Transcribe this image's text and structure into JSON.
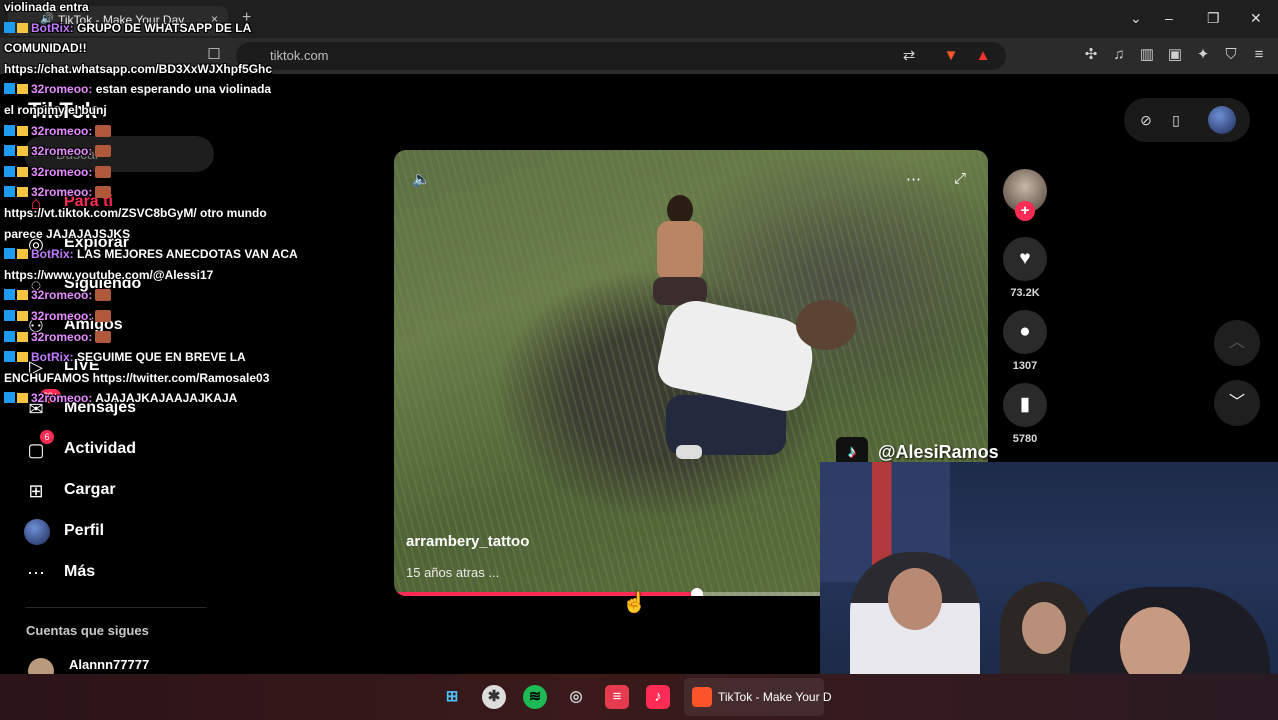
{
  "browser": {
    "tab_title": "TikTok - Make Your Day",
    "tab_close": "×",
    "new_tab": "+",
    "url": "tiktok.com"
  },
  "sidebar": {
    "logo": "TikTok",
    "search_placeholder": "Buscar",
    "items": [
      {
        "label": "Para ti",
        "icon": "home-icon"
      },
      {
        "label": "Explorar",
        "icon": "compass-icon"
      },
      {
        "label": "Siguiendo",
        "icon": "following-icon"
      },
      {
        "label": "Amigos",
        "icon": "friends-icon"
      },
      {
        "label": "LIVE",
        "icon": "live-icon"
      },
      {
        "label": "Mensajes",
        "icon": "messages-icon",
        "badge": "99+"
      },
      {
        "label": "Actividad",
        "icon": "activity-icon",
        "badge": "6"
      },
      {
        "label": "Cargar",
        "icon": "upload-icon"
      },
      {
        "label": "Perfil",
        "icon": "profile-avatar"
      },
      {
        "label": "Más",
        "icon": "more-icon"
      }
    ],
    "following_title": "Cuentas que sigues",
    "following_users": [
      "Alannn77777"
    ]
  },
  "video": {
    "author": "arrambery_tattoo",
    "posted": "15 años atras ...",
    "progress": 0.51
  },
  "actions": {
    "likes": "73.2K",
    "comments": "1307",
    "saves": "5780"
  },
  "stream": {
    "handle": "@AlesiRamos"
  },
  "chat": [
    {
      "user": "",
      "text": "violinada entra"
    },
    {
      "user": "BotRix:",
      "text": " GRUPO DE WHATSAPP DE LA"
    },
    {
      "user": "",
      "text": "COMUNIDAD!!"
    },
    {
      "user": "",
      "text": "https://chat.whatsapp.com/BD3XxWJXhpf5Ghc"
    },
    {
      "user": "32romeoo:",
      "text": " estan esperando una violinada"
    },
    {
      "user": "",
      "text": "el ronpimy el bunj"
    },
    {
      "user": "32romeoo:",
      "text": ""
    },
    {
      "user": "32romeoo:",
      "text": ""
    },
    {
      "user": "32romeoo:",
      "text": ""
    },
    {
      "user": "32romeoo:",
      "text": ""
    },
    {
      "user": "",
      "text": "https://vt.tiktok.com/ZSVC8bGyM/ otro mundo"
    },
    {
      "user": "",
      "text": "parece JAJAJAJSJKS"
    },
    {
      "user": "BotRix:",
      "text": " LAS MEJORES ANECDOTAS VAN ACA"
    },
    {
      "user": "",
      "text": "https://www.youtube.com/@Alessi17"
    },
    {
      "user": "32romeoo:",
      "text": ""
    },
    {
      "user": "32romeoo:",
      "text": ""
    },
    {
      "user": "32romeoo:",
      "text": ""
    },
    {
      "user": "BotRix:",
      "text": " SEGUIME QUE EN BREVE LA"
    },
    {
      "user": "",
      "text": "ENCHUFAMOS https://twitter.com/Ramosale03"
    },
    {
      "user": "32romeoo:",
      "text": " AJAJAJKAJAAJAJKAJA"
    }
  ],
  "taskbar": {
    "active_label": "TikTok - Make Your D"
  }
}
